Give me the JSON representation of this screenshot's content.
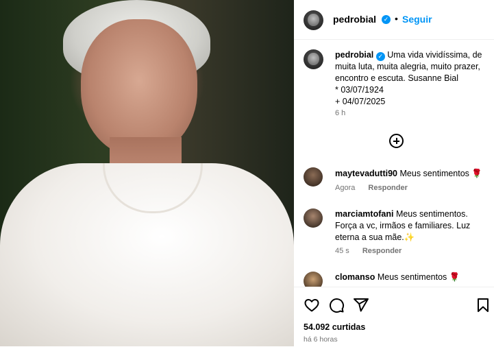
{
  "post": {
    "username": "pedrobial",
    "follow_label": "Seguir",
    "separator": "•",
    "caption_text": "Uma vida vividíssima, de muita luta, muita alegria, muito prazer, encontro e escuta. Susanne Bial",
    "caption_line2": "* 03/07/1924",
    "caption_line3": "+ 04/07/2025",
    "caption_age": "6 h",
    "likes": "54.092 curtidas",
    "posted_ago": "há 6 horas"
  },
  "comments": [
    {
      "username": "maytevadutti90",
      "text": "Meus sentimentos 🌹",
      "age": "Agora",
      "reply": "Responder"
    },
    {
      "username": "marciamtofani",
      "text": "Meus sentimentos. Força a vc, irmãos e familiares. Luz eterna a sua mãe.✨",
      "age": "45 s",
      "reply": "Responder"
    },
    {
      "username": "clomanso",
      "text": "Meus sentimentos 🌹"
    }
  ],
  "icons": {
    "verified": "verified-badge-icon",
    "load_more": "plus-circle-icon",
    "like": "heart-icon",
    "comment": "comment-icon",
    "share": "share-icon",
    "save": "bookmark-icon"
  },
  "colors": {
    "accent": "#0095f6",
    "muted": "#737373"
  }
}
